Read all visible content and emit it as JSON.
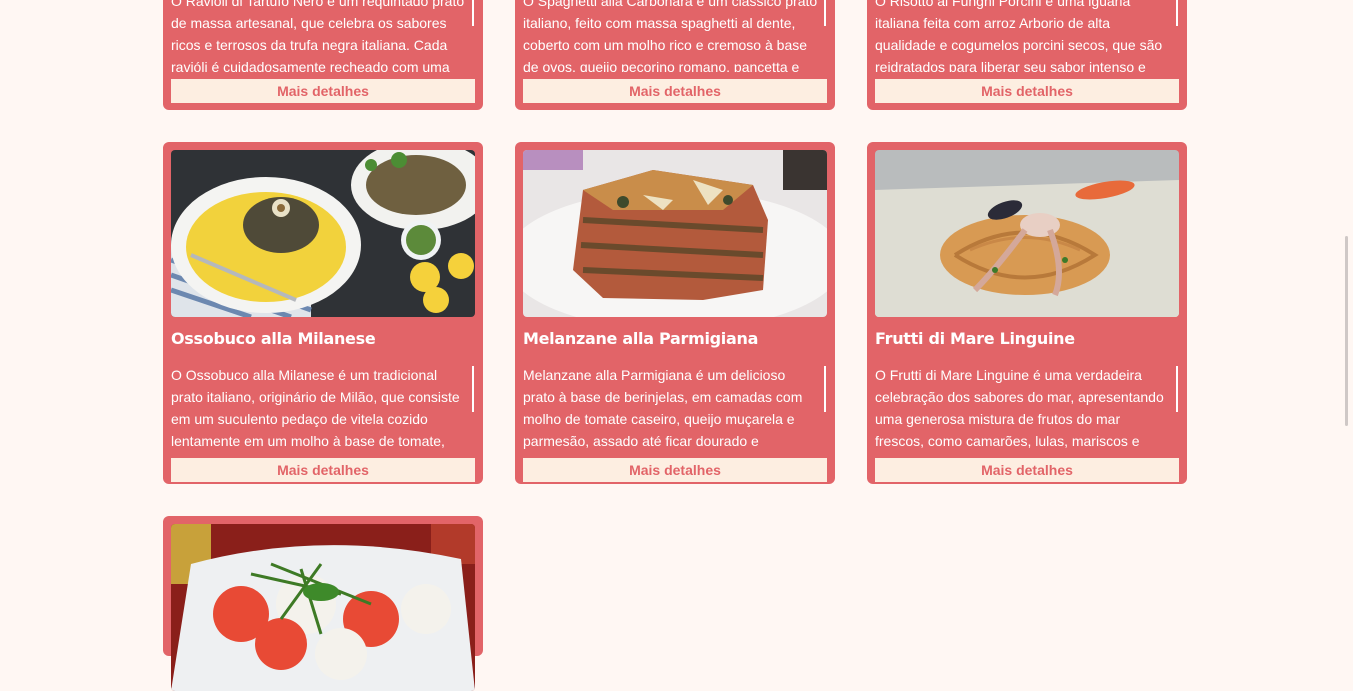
{
  "cards_top": [
    {
      "desc": "O Ravióli di Tartufo Nero é um requintado prato de massa artesanal, que celebra os sabores ricos e terrosos da trufa negra italiana. Cada ravióli é cuidadosamente recheado com uma",
      "more_label": "Mais detalhes"
    },
    {
      "desc": "O Spaghetti alla Carbonara é um clássico prato italiano, feito com massa spaghetti al dente, coberto com um molho rico e cremoso à base de ovos, queijo pecorino romano, pancetta e",
      "more_label": "Mais detalhes"
    },
    {
      "desc": "O Risotto ai Funghi Porcini é uma iguaria italiana feita com arroz Arborio de alta qualidade e cogumelos porcini secos, que são reidratados para liberar seu sabor intenso e terroso. O arroz",
      "more_label": "Mais detalhes"
    }
  ],
  "cards_mid": [
    {
      "title": "Ossobuco alla Milanese",
      "desc": "O Ossobuco alla Milanese é um tradicional prato italiano, originário de Milão, que consiste em um suculento pedaço de vitela cozido lentamente em um molho à base de tomate, vinho branco e",
      "more_label": "Mais detalhes"
    },
    {
      "title": "Melanzane alla Parmigiana",
      "desc": "Melanzane alla Parmigiana é um delicioso prato à base de berinjelas, em camadas com molho de tomate caseiro, queijo muçarela e parmesão, assado até ficar dourado e borbulhante. Uma",
      "more_label": "Mais detalhes"
    },
    {
      "title": "Frutti di Mare Linguine",
      "desc": "O Frutti di Mare Linguine é uma verdadeira celebração dos sabores do mar, apresentando uma generosa mistura de frutos do mar frescos, como camarões, lulas, mariscos e vieiras.",
      "more_label": "Mais detalhes"
    }
  ],
  "colors": {
    "card": "#e26468",
    "button_bg": "#fdeee1",
    "page_bg": "#fff7f3"
  }
}
